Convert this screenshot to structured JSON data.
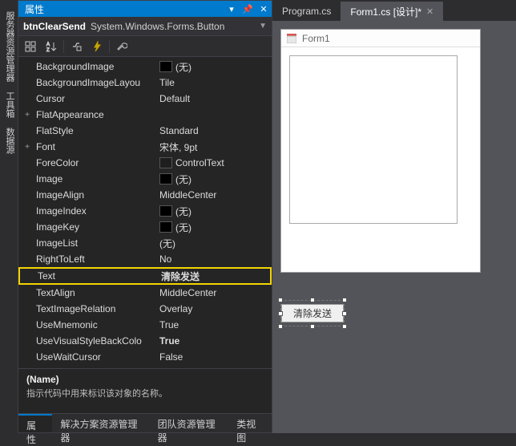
{
  "vertical_tabs": [
    "服务器资源管理器",
    "工具箱",
    "数据源"
  ],
  "panel": {
    "title": "属性",
    "pin_icon": "pin-icon",
    "close_icon": "close-icon",
    "selector": {
      "name": "btnClearSend",
      "type": "System.Windows.Forms.Button"
    },
    "props": [
      {
        "exp": "",
        "name": "BackgroundImage",
        "swatch": true,
        "value": "(无)"
      },
      {
        "exp": "",
        "name": "BackgroundImageLayou",
        "value": "Tile"
      },
      {
        "exp": "",
        "name": "Cursor",
        "value": "Default"
      },
      {
        "exp": "+",
        "name": "FlatAppearance",
        "value": ""
      },
      {
        "exp": "",
        "name": "FlatStyle",
        "value": "Standard"
      },
      {
        "exp": "+",
        "name": "Font",
        "value": "宋体, 9pt"
      },
      {
        "exp": "",
        "name": "ForeColor",
        "swatch": "ctrl",
        "value": "ControlText"
      },
      {
        "exp": "",
        "name": "Image",
        "swatch": true,
        "value": "(无)"
      },
      {
        "exp": "",
        "name": "ImageAlign",
        "value": "MiddleCenter"
      },
      {
        "exp": "",
        "name": "ImageIndex",
        "swatch": true,
        "value": "(无)"
      },
      {
        "exp": "",
        "name": "ImageKey",
        "swatch": true,
        "value": "(无)"
      },
      {
        "exp": "",
        "name": "ImageList",
        "value": "(无)"
      },
      {
        "exp": "",
        "name": "RightToLeft",
        "value": "No"
      },
      {
        "exp": "",
        "name": "Text",
        "value": "清除发送",
        "highlight": true,
        "bold": true
      },
      {
        "exp": "",
        "name": "TextAlign",
        "value": "MiddleCenter"
      },
      {
        "exp": "",
        "name": "TextImageRelation",
        "value": "Overlay"
      },
      {
        "exp": "",
        "name": "UseMnemonic",
        "value": "True"
      },
      {
        "exp": "",
        "name": "UseVisualStyleBackColo",
        "value": "True",
        "bold": true
      },
      {
        "exp": "",
        "name": "UseWaitCursor",
        "value": "False"
      }
    ],
    "help": {
      "title": "(Name)",
      "desc": "指示代码中用来标识该对象的名称。"
    },
    "tabs": [
      {
        "label": "属性",
        "active": true
      },
      {
        "label": "解决方案资源管理器"
      },
      {
        "label": "团队资源管理器"
      },
      {
        "label": "类视图"
      }
    ]
  },
  "designer": {
    "doc_tabs": [
      {
        "label": "Program.cs"
      },
      {
        "label": "Form1.cs [设计]*",
        "active": true
      }
    ],
    "form_title": "Form1",
    "button_text": "清除发送"
  }
}
